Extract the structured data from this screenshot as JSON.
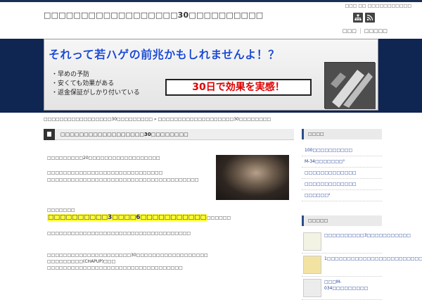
{
  "site_title": "□□□□□□□□□□□□□□□□□□30□□□□□□□□□□",
  "top_links": "□□□ □□ □□□□□□□□□□□",
  "header": {
    "rss": "RSS",
    "sitemap": "sitemap"
  },
  "nav": [
    "□□□",
    "□□□□□"
  ],
  "banner": {
    "title": "それって若ハゲの前兆かもしれませんよ！？",
    "bullets": [
      "・早めの予防",
      "・安くても効果がある",
      "・返金保証がしかり付いている"
    ],
    "cta": "30日で効果を実感！"
  },
  "breadcrumb": "□□□□□□□□□□□□□□□□□30□□□□□□□□□ » □□□□□□□□□□□□□□□□□□□30□□□□□□□□",
  "post_title": "□□□□□□□□□□□□□□□□□□30□□□□□□□□",
  "content": {
    "p1": "□□□□□□□□□20□□□□□□□□□□□□□□□□□□",
    "p2": "□□□□□□□□□□□□□□□□□□□□□□□□□□□□□",
    "p3": "□□□□□□□□□□□□□□□□□□□□□□□□□□□□□□□□□□□□□□",
    "p4": "□□□□□□□",
    "hl": "□□□□□□□□□□3□□□□6□□□□□□□□□□□",
    "hl_suffix": "□□□□□□",
    "p5": "□□□□□□□□□□□□□□□□□□□□□□□□□□□□□□□□□□□□",
    "p6": "□□□□□□□□□□□□□□□□□□□□□30□□□□□□□□□□□□□□□□□□",
    "p7": "□□□□□□□□□(CHAPUP)□□□",
    "p8": "□□□□□□□□□□□□□□□□□□□□□□□□□□□□□□□□□□"
  },
  "sidebar": {
    "title1": "□□□□",
    "items": [
      "100□□□□□□□□□□",
      "M-34□□□□□□□²",
      "□□□□□□□□□□□□□",
      "□□□□□□□□□□□□□",
      "□□□□□□²"
    ],
    "title2": "□□□□□",
    "posts": [
      "□□□□□□□□□□3□□□□□□□□□□□",
      "1□□□□□□□□□□□□□□□□□□□□□□□□□□",
      "□□□M-034□□□□□□□□□"
    ]
  }
}
